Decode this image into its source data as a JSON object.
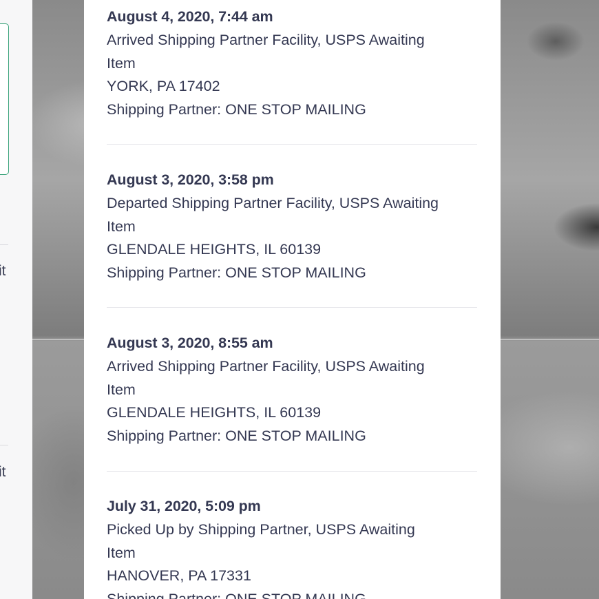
{
  "left_fragments": [
    "it",
    "it"
  ],
  "events": [
    {
      "date": "August 4, 2020, 7:44 am",
      "status_1": "Arrived Shipping Partner Facility, USPS Awaiting",
      "status_2": "Item",
      "location": "YORK, PA 17402",
      "partner": "Shipping Partner:  ONE STOP MAILING"
    },
    {
      "date": "August 3, 2020, 3:58 pm",
      "status_1": "Departed Shipping Partner Facility, USPS Awaiting",
      "status_2": "Item",
      "location": "GLENDALE HEIGHTS, IL 60139",
      "partner": "Shipping Partner:  ONE STOP MAILING"
    },
    {
      "date": "August 3, 2020, 8:55 am",
      "status_1": "Arrived Shipping Partner Facility, USPS Awaiting",
      "status_2": "Item",
      "location": "GLENDALE HEIGHTS, IL 60139",
      "partner": "Shipping Partner:  ONE STOP MAILING"
    },
    {
      "date": "July 31, 2020, 5:09 pm",
      "status_1": "Picked Up by Shipping Partner, USPS Awaiting",
      "status_2": "Item",
      "location": "HANOVER, PA 17331",
      "partner": "Shipping Partner:  ONE STOP MAILING"
    }
  ]
}
